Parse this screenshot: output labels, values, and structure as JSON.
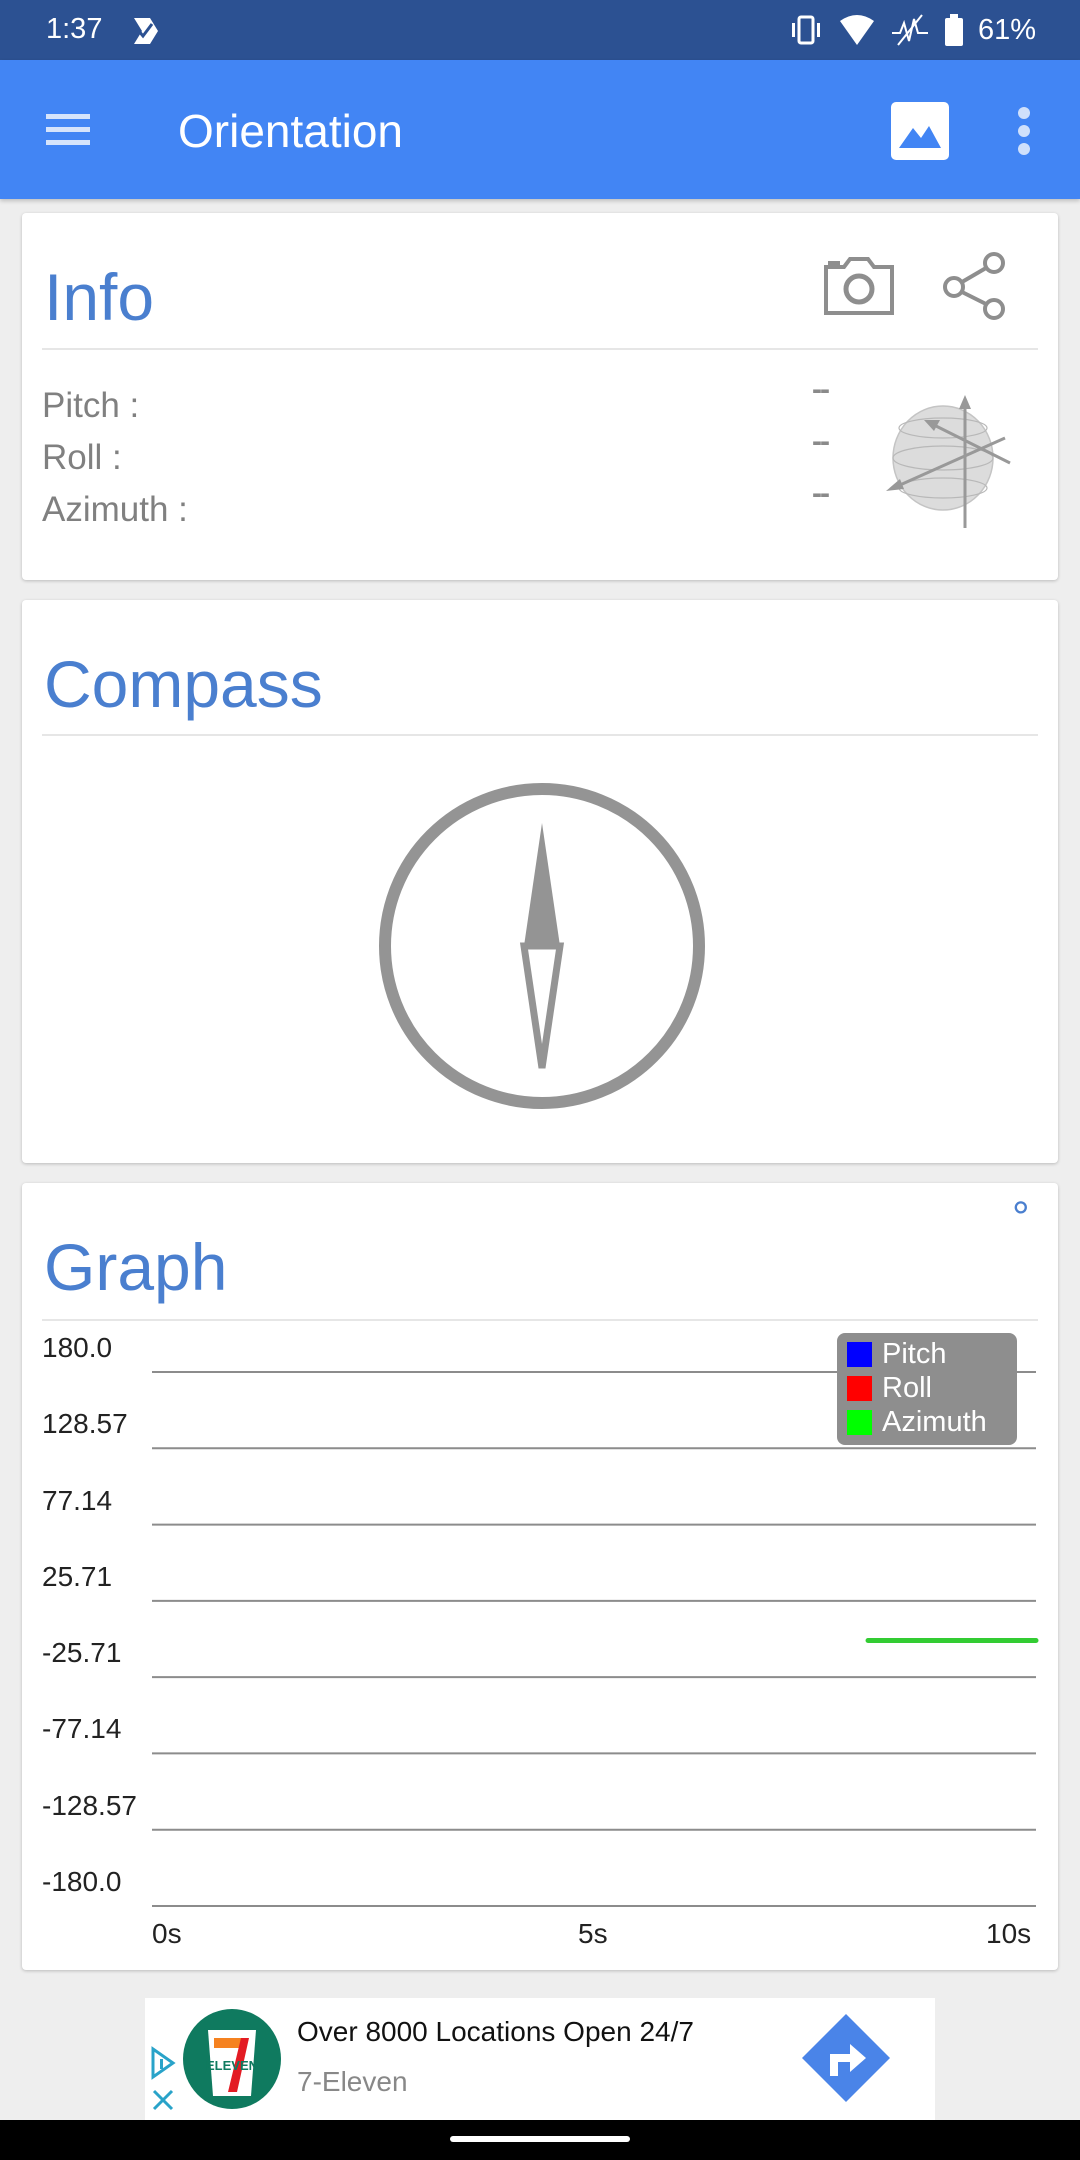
{
  "status_bar": {
    "time": "1:37",
    "battery_percent": "61%",
    "icons": [
      "notification-check-icon",
      "vibrate-icon",
      "wifi-icon",
      "no-signal-icon",
      "battery-icon"
    ]
  },
  "app_bar": {
    "title": "Orientation",
    "icons": [
      "menu-icon",
      "image-icon",
      "more-vert-icon"
    ]
  },
  "info_card": {
    "title": "Info",
    "actions": [
      "camera-icon",
      "share-icon"
    ],
    "rows": [
      {
        "label": "Pitch :",
        "value": "--"
      },
      {
        "label": "Roll :",
        "value": "--"
      },
      {
        "label": "Azimuth :",
        "value": "--"
      }
    ],
    "illustration": "orientation-sphere-icon"
  },
  "compass_card": {
    "title": "Compass",
    "illustration": "compass-icon"
  },
  "graph_card": {
    "title": "Graph",
    "unit_symbol": "°"
  },
  "chart_data": {
    "type": "line",
    "title": "",
    "xlabel": "",
    "ylabel": "",
    "x_ticks": [
      "0s",
      "5s",
      "10s"
    ],
    "y_ticks": [
      "180.0",
      "128.57",
      "77.14",
      "25.71",
      "-25.71",
      "-77.14",
      "-128.57",
      "-180.0"
    ],
    "xlim": [
      0,
      10
    ],
    "ylim": [
      -180,
      180
    ],
    "grid": true,
    "legend_position": "top-right",
    "series": [
      {
        "name": "Pitch",
        "color": "#0000ff",
        "x": [],
        "y": []
      },
      {
        "name": "Roll",
        "color": "#ff0000",
        "x": [],
        "y": []
      },
      {
        "name": "Azimuth",
        "color": "#33cc33",
        "x": [
          8.1,
          10
        ],
        "y": [
          -1,
          -1
        ]
      }
    ]
  },
  "ad": {
    "headline": "Over 8000 Locations Open 24/7",
    "advertiser": "7-Eleven",
    "logo": "7-eleven-logo",
    "cta_icon": "directions-icon",
    "adchoices_icon": "adchoices-icon",
    "close_icon": "close-icon"
  },
  "colors": {
    "status_bar": "#2c5192",
    "app_bar": "#4285f4",
    "card_title": "#4a7fcf",
    "icon_gray": "#8e8e8e"
  }
}
